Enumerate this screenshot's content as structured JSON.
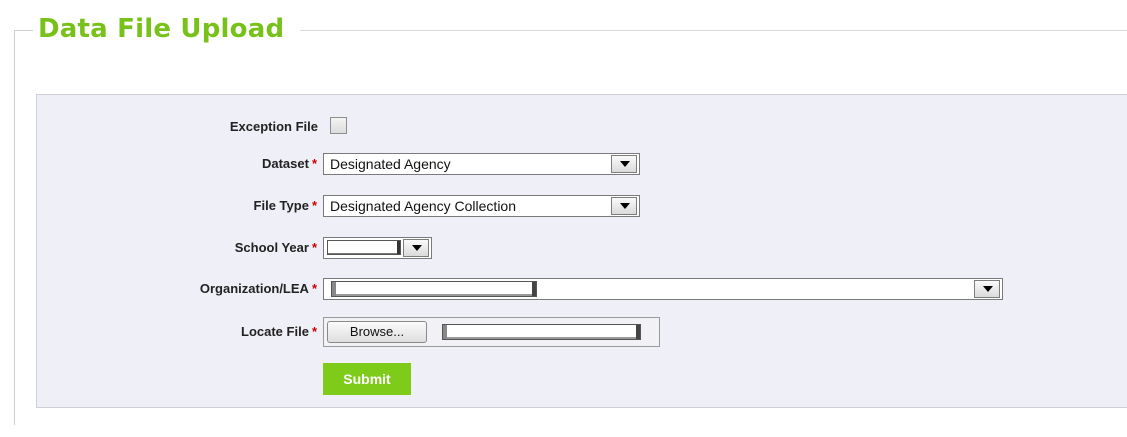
{
  "fieldset": {
    "legend": "Data File Upload"
  },
  "form": {
    "exception_file": {
      "label": "Exception File",
      "checked": false
    },
    "dataset": {
      "label": "Dataset",
      "required_marker": "*",
      "value": "Designated Agency"
    },
    "file_type": {
      "label": "File Type",
      "required_marker": "*",
      "value": "Designated Agency Collection"
    },
    "school_year": {
      "label": "School Year",
      "required_marker": "*",
      "value": ""
    },
    "organization": {
      "label": "Organization/LEA",
      "required_marker": "*",
      "value": ""
    },
    "locate_file": {
      "label": "Locate File",
      "required_marker": "*",
      "browse_label": "Browse..."
    },
    "submit_label": "Submit"
  },
  "colors": {
    "accent_green": "#78c11a",
    "submit_green": "#7ecb1a",
    "panel_bg": "#efeff7",
    "required_red": "#cc0000"
  }
}
